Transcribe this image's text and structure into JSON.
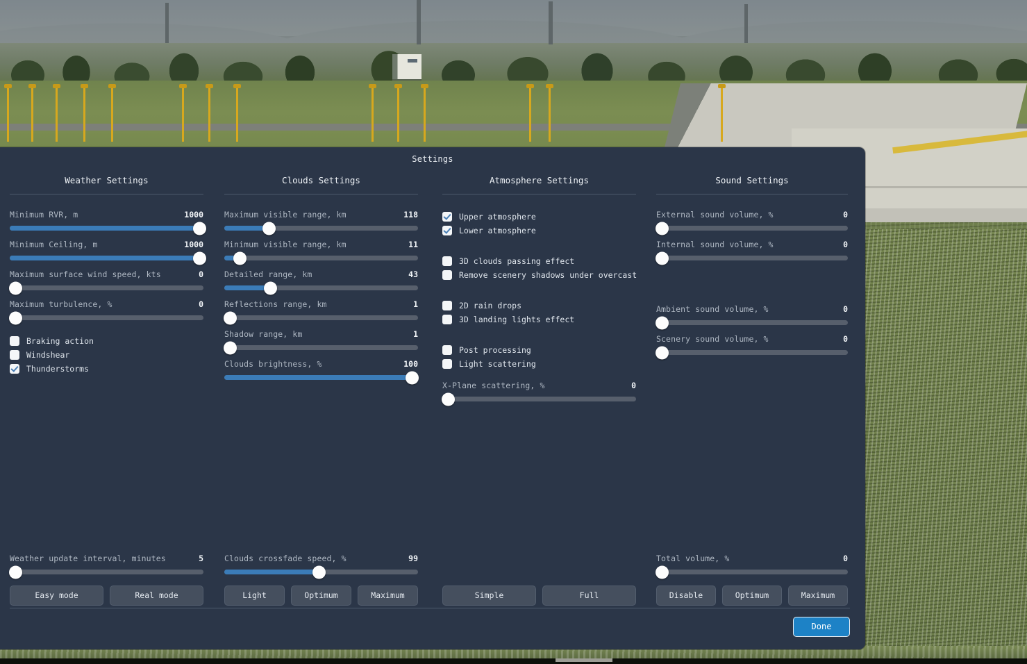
{
  "dialog": {
    "title": "Settings",
    "done_label": "Done"
  },
  "columns": {
    "weather": {
      "header": "Weather Settings",
      "sliders": [
        {
          "label": "Minimum RVR, m",
          "value": "1000",
          "fill_pct": 98
        },
        {
          "label": "Minimum Ceiling, m",
          "value": "1000",
          "fill_pct": 98
        },
        {
          "label": "Maximum surface wind speed, kts",
          "value": "0",
          "fill_pct": 0
        },
        {
          "label": "Maximum turbulence, %",
          "value": "0",
          "fill_pct": 0
        }
      ],
      "checkboxes": [
        {
          "label": "Braking action",
          "checked": false
        },
        {
          "label": "Windshear",
          "checked": false
        },
        {
          "label": "Thunderstorms",
          "checked": true
        }
      ],
      "bottom_slider": {
        "label": "Weather update interval, minutes",
        "value": "5",
        "fill_pct": 0
      },
      "buttons": [
        "Easy mode",
        "Real mode"
      ]
    },
    "clouds": {
      "header": "Clouds Settings",
      "sliders": [
        {
          "label": "Maximum visible range, km",
          "value": "118",
          "fill_pct": 23
        },
        {
          "label": "Minimum visible range, km",
          "value": "11",
          "fill_pct": 8
        },
        {
          "label": "Detailed range, km",
          "value": "43",
          "fill_pct": 24
        },
        {
          "label": "Reflections range, km",
          "value": "1",
          "fill_pct": 0
        },
        {
          "label": "Shadow range, km",
          "value": "1",
          "fill_pct": 0
        },
        {
          "label": "Clouds brightness, %",
          "value": "100",
          "fill_pct": 97
        }
      ],
      "bottom_slider": {
        "label": "Clouds crossfade speed, %",
        "value": "99",
        "fill_pct": 49
      },
      "buttons": [
        "Light",
        "Optimum",
        "Maximum"
      ]
    },
    "atmosphere": {
      "header": "Atmosphere Settings",
      "checkbox_groups": [
        [
          {
            "label": "Upper atmosphere",
            "checked": true
          },
          {
            "label": "Lower atmosphere",
            "checked": true
          }
        ],
        [
          {
            "label": "3D clouds passing effect",
            "checked": false
          },
          {
            "label": "Remove scenery shadows under overcast",
            "checked": false
          }
        ],
        [
          {
            "label": "2D rain drops",
            "checked": false
          },
          {
            "label": "3D landing lights effect",
            "checked": false
          }
        ],
        [
          {
            "label": "Post processing",
            "checked": false
          },
          {
            "label": "Light scattering",
            "checked": false
          }
        ]
      ],
      "scattering_slider": {
        "label": "X-Plane scattering, %",
        "value": "0",
        "fill_pct": 0
      },
      "buttons": [
        "Simple",
        "Full"
      ]
    },
    "sound": {
      "header": "Sound Settings",
      "sliders": [
        {
          "label": "External sound volume, %",
          "value": "0",
          "fill_pct": 0
        },
        {
          "label": "Internal sound volume, %",
          "value": "0",
          "fill_pct": 0
        }
      ],
      "sliders2": [
        {
          "label": "Ambient sound volume, %",
          "value": "0",
          "fill_pct": 0
        },
        {
          "label": "Scenery sound volume, %",
          "value": "0",
          "fill_pct": 0
        }
      ],
      "bottom_slider": {
        "label": "Total volume, %",
        "value": "0",
        "fill_pct": 0
      },
      "buttons": [
        "Disable",
        "Optimum",
        "Maximum"
      ]
    }
  },
  "colors": {
    "panel_bg": "#2b3648",
    "accent_blue": "#3b7cb8",
    "done_blue": "#1d82c6",
    "track_grey": "#575f6c"
  }
}
